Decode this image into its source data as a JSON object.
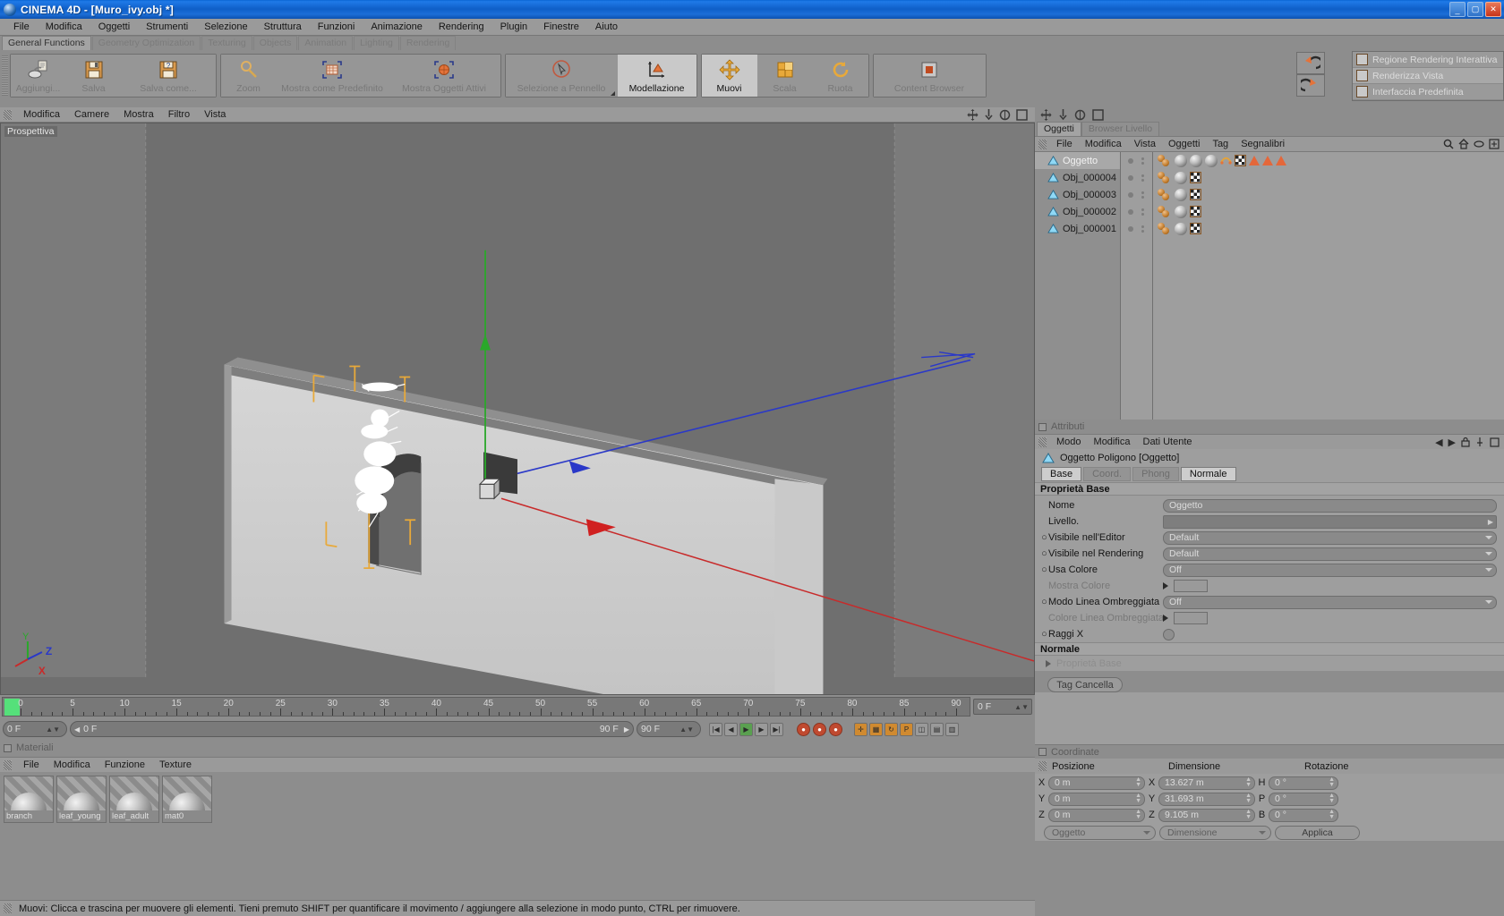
{
  "titlebar": {
    "title": "CINEMA 4D - [Muro_ivy.obj *]",
    "minimize": "_",
    "maximize": "▢",
    "close": "✕"
  },
  "menubar": {
    "items": [
      "File",
      "Modifica",
      "Oggetti",
      "Strumenti",
      "Selezione",
      "Struttura",
      "Funzioni",
      "Animazione",
      "Rendering",
      "Plugin",
      "Finestre",
      "Aiuto"
    ]
  },
  "palette_tabs": [
    {
      "label": "General Functions",
      "active": true
    },
    {
      "label": "Geometry Optimization",
      "active": false
    },
    {
      "label": "Texturing",
      "active": false
    },
    {
      "label": "Objects",
      "active": false
    },
    {
      "label": "Animation",
      "active": false
    },
    {
      "label": "Lighting",
      "active": false
    },
    {
      "label": "Rendering",
      "active": false
    }
  ],
  "toolbar": {
    "group1": [
      {
        "label": "Aggiungi...",
        "icon": "add-object-icon",
        "active": false,
        "dim": true
      },
      {
        "label": "Salva",
        "icon": "save-icon",
        "active": false,
        "dim": true
      },
      {
        "label": "Salva come...",
        "icon": "save-as-icon",
        "active": false,
        "dim": true
      }
    ],
    "group2": [
      {
        "label": "Zoom",
        "icon": "magnifier-icon",
        "active": false,
        "dim": true
      },
      {
        "label": "Mostra come Predefinito",
        "icon": "show-default-icon",
        "active": false,
        "dim": true
      },
      {
        "label": "Mostra Oggetti Attivi",
        "icon": "show-active-objects-icon",
        "active": false,
        "dim": true
      }
    ],
    "group3": [
      {
        "label": "Selezione a Pennello",
        "icon": "brush-select-icon",
        "active": false,
        "dim": true
      },
      {
        "label": "Modellazione",
        "icon": "modeling-axis-icon",
        "active": true,
        "dim": false
      }
    ],
    "group4": [
      {
        "label": "Muovi",
        "icon": "move-icon",
        "active": true,
        "dim": false
      },
      {
        "label": "Scala",
        "icon": "scale-icon",
        "active": false,
        "dim": true
      },
      {
        "label": "Ruota",
        "icon": "rotate-icon",
        "active": false,
        "dim": true
      }
    ],
    "group5": [
      {
        "label": "Content Browser",
        "icon": "content-browser-icon",
        "active": false,
        "dim": true
      }
    ],
    "undo_label": "undo-icon",
    "redo_label": "redo-icon"
  },
  "right_flyout": {
    "items": [
      {
        "label": "Regione Rendering Interattiva",
        "icon": "interactive-render-region-icon",
        "highlight": false
      },
      {
        "label": "Renderizza Vista",
        "icon": "render-view-icon",
        "highlight": true
      },
      {
        "label": "Interfaccia Predefinita",
        "icon": "default-layout-icon",
        "highlight": false
      }
    ]
  },
  "viewport": {
    "menu": [
      "Modifica",
      "Camere",
      "Mostra",
      "Filtro",
      "Vista"
    ],
    "label": "Prospettiva",
    "axis_labels": {
      "x": "X",
      "y": "Y",
      "z": "Z"
    }
  },
  "timeline": {
    "ticks": [
      0,
      5,
      10,
      15,
      20,
      25,
      30,
      35,
      40,
      45,
      50,
      55,
      60,
      65,
      70,
      75,
      80,
      85,
      90
    ],
    "end_field": "0 F",
    "current_frame": "0 F",
    "from_frame": "0 F",
    "to_frame": "90 F",
    "preview_end": "90 F"
  },
  "materials": {
    "panel_title": "Materiali",
    "menu": [
      "File",
      "Modifica",
      "Funzione",
      "Texture"
    ],
    "items": [
      {
        "name": "branch"
      },
      {
        "name": "leaf_young"
      },
      {
        "name": "leaf_adult"
      },
      {
        "name": "mat0"
      }
    ]
  },
  "statusbar": {
    "text": "Muovi: Clicca e trascina per muovere gli elementi. Tieni premuto SHIFT per quantificare il movimento / aggiungere alla selezione in modo punto, CTRL per rimuovere."
  },
  "object_manager": {
    "tabs": [
      {
        "label": "Oggetti",
        "active": true
      },
      {
        "label": "Browser Livello",
        "active": false
      }
    ],
    "menu": [
      "File",
      "Modifica",
      "Vista",
      "Oggetti",
      "Tag",
      "Segnalibri"
    ],
    "rows": [
      {
        "name": "Oggetto",
        "selected": true,
        "tags": [
          "material",
          "material",
          "material",
          "material",
          "uv",
          "checker",
          "tri",
          "tri",
          "tri"
        ]
      },
      {
        "name": "Obj_000004",
        "selected": false,
        "tags": [
          "material",
          "checker"
        ]
      },
      {
        "name": "Obj_000003",
        "selected": false,
        "tags": [
          "material",
          "checker"
        ]
      },
      {
        "name": "Obj_000002",
        "selected": false,
        "tags": [
          "material",
          "checker"
        ]
      },
      {
        "name": "Obj_000001",
        "selected": false,
        "tags": [
          "material",
          "checker"
        ]
      }
    ]
  },
  "attributes": {
    "panel_title": "Attributi",
    "menu": [
      "Modo",
      "Modifica",
      "Dati Utente"
    ],
    "object_label": "Oggetto Poligono [Oggetto]",
    "tabs": [
      {
        "label": "Base",
        "active": true
      },
      {
        "label": "Coord.",
        "active": false
      },
      {
        "label": "Phong",
        "active": false
      },
      {
        "label": "Normale",
        "active": true
      }
    ],
    "section_base": "Proprietà Base",
    "properties": [
      {
        "label": "Nome",
        "value": "Oggetto",
        "type": "text",
        "bullet": false,
        "dim": false
      },
      {
        "label": "Livello.",
        "value": "",
        "type": "text-plain",
        "bullet": false,
        "dim": false
      },
      {
        "label": "Visibile nell'Editor",
        "value": "Default",
        "type": "dropdown",
        "bullet": true,
        "dim": false
      },
      {
        "label": "Visibile nel Rendering",
        "value": "Default",
        "type": "dropdown",
        "bullet": true,
        "dim": false
      },
      {
        "label": "Usa Colore",
        "value": "Off",
        "type": "dropdown",
        "bullet": true,
        "dim": false
      },
      {
        "label": "Mostra Colore",
        "value": "",
        "type": "swatch",
        "bullet": false,
        "dim": true
      },
      {
        "label": "Modo Linea Ombreggiata",
        "value": "Off",
        "type": "dropdown",
        "bullet": true,
        "dim": false
      },
      {
        "label": "Colore Linea Ombreggiata",
        "value": "",
        "type": "swatch",
        "bullet": false,
        "dim": true
      },
      {
        "label": "Raggi X",
        "value": "",
        "type": "toggle",
        "bullet": true,
        "dim": false
      }
    ],
    "section_normale": "Normale",
    "sub_base": "Proprietà Base",
    "delete_tag_button": "Tag Cancella"
  },
  "coordinates": {
    "panel_title": "Coordinate",
    "columns": [
      "Posizione",
      "Dimensione",
      "Rotazione"
    ],
    "rows": [
      {
        "axis": "X",
        "position": "0 m",
        "size_axis": "X",
        "size": "13.627 m",
        "rot_axis": "H",
        "rot": "0 °"
      },
      {
        "axis": "Y",
        "position": "0 m",
        "size_axis": "Y",
        "size": "31.693 m",
        "rot_axis": "P",
        "rot": "0 °"
      },
      {
        "axis": "Z",
        "position": "0 m",
        "size_axis": "Z",
        "size": "9.105 m",
        "rot_axis": "B",
        "rot": "0 °"
      }
    ],
    "select_object": "Oggetto",
    "select_size": "Dimensione",
    "apply_button": "Applica"
  },
  "colors": {
    "accent_orange": "#e4873a",
    "titlebar_blue": "#1163cc",
    "panel_gray": "#9a9a9a",
    "axis_x": "#cc2a2a",
    "axis_y": "#2aaa2a",
    "axis_z": "#2a2acc"
  }
}
